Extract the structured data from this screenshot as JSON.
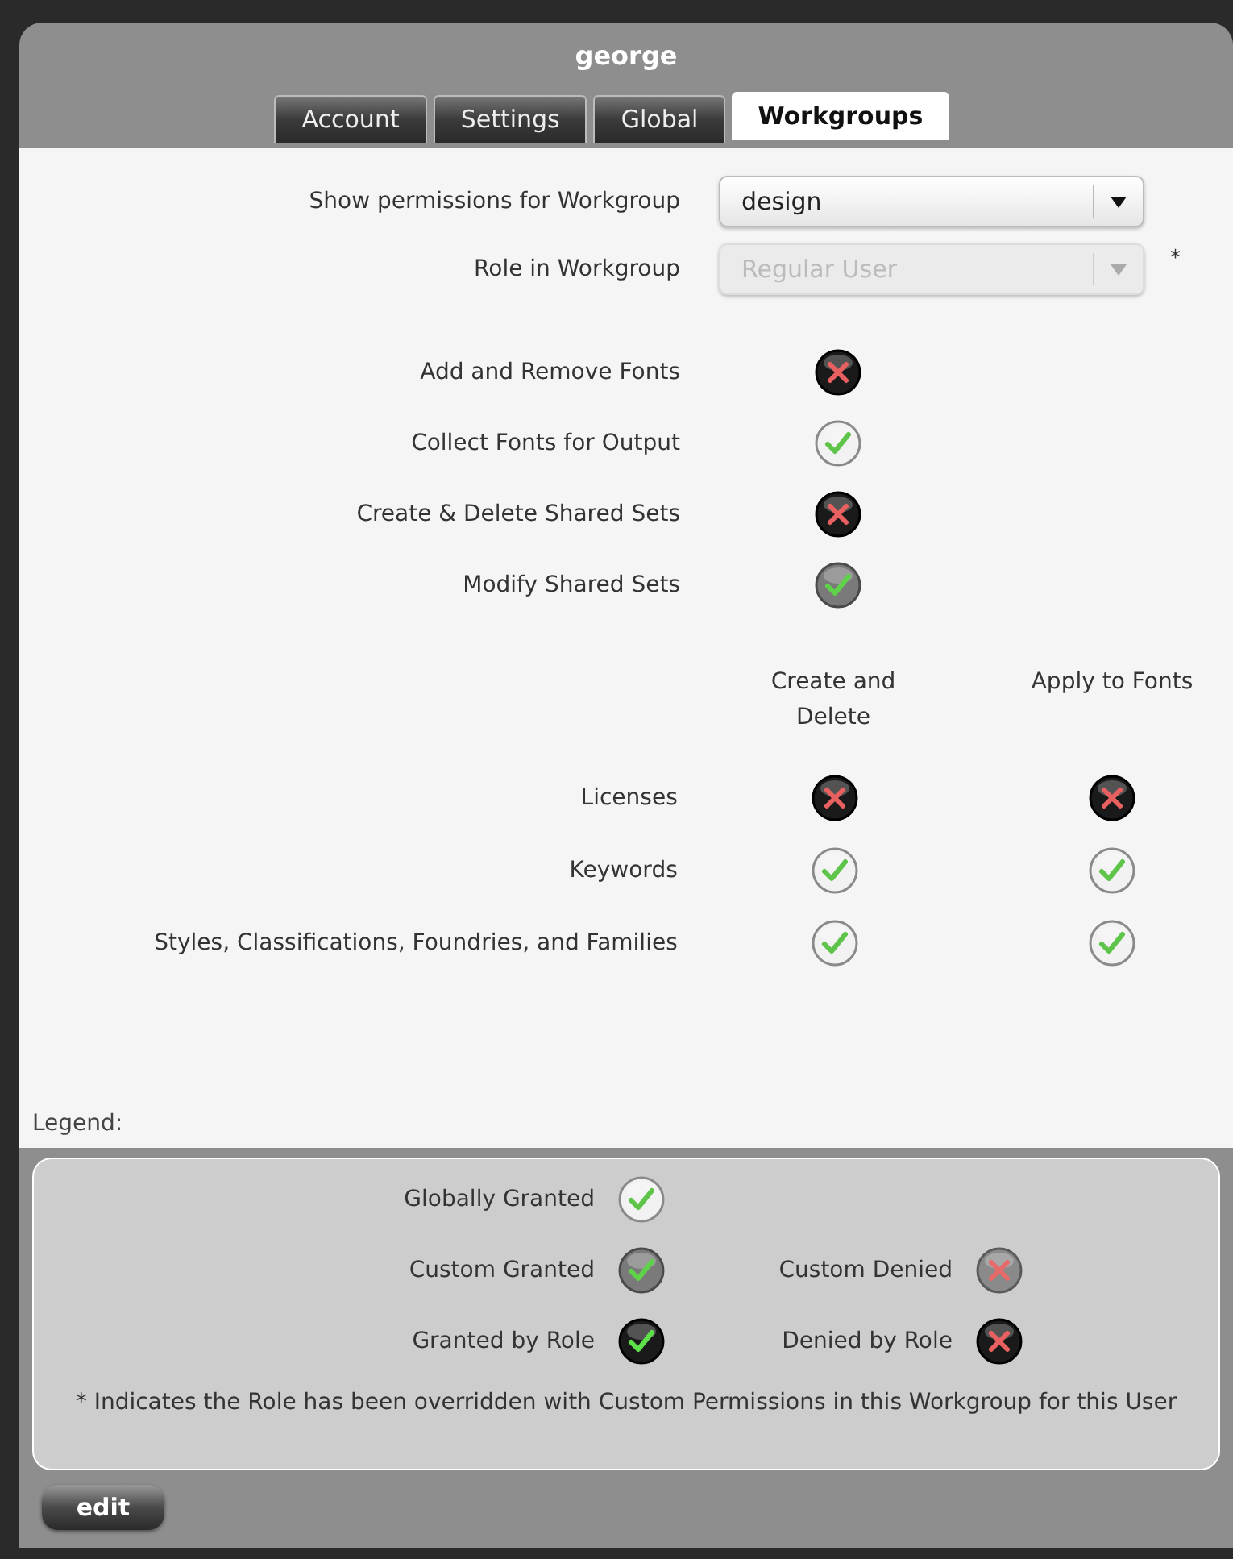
{
  "title": "george",
  "tabs": [
    {
      "label": "Account",
      "selected": false
    },
    {
      "label": "Settings",
      "selected": false
    },
    {
      "label": "Global",
      "selected": false
    },
    {
      "label": "Workgroups",
      "selected": true
    }
  ],
  "workgroup": {
    "label": "Show permissions for Workgroup",
    "value": "design",
    "disabled": false
  },
  "role": {
    "label": "Role in Workgroup",
    "value": "Regular User",
    "disabled": true,
    "overridden_mark": "*"
  },
  "permissions": [
    {
      "label": "Add and Remove Fonts",
      "kind": "role_denied"
    },
    {
      "label": "Collect Fonts for Output",
      "kind": "global_granted"
    },
    {
      "label": "Create & Delete Shared Sets",
      "kind": "role_denied"
    },
    {
      "label": "Modify Shared Sets",
      "kind": "custom_granted"
    }
  ],
  "matrix": {
    "columns": [
      "Create and Delete",
      "Apply to Fonts"
    ],
    "rows": [
      {
        "label": "Licenses",
        "cells": [
          {
            "kind": "role_denied"
          },
          {
            "kind": "role_denied"
          }
        ]
      },
      {
        "label": "Keywords",
        "cells": [
          {
            "kind": "global_granted"
          },
          {
            "kind": "global_granted"
          }
        ]
      },
      {
        "label": "Styles, Classifications, Foundries, and Families",
        "cells": [
          {
            "kind": "global_granted"
          },
          {
            "kind": "global_granted"
          }
        ]
      }
    ]
  },
  "legend": {
    "title": "Legend:",
    "items": [
      {
        "label": "Globally Granted",
        "kind": "global_granted"
      },
      {
        "label": "Custom Granted",
        "kind": "custom_granted"
      },
      {
        "label": "Custom Denied",
        "kind": "custom_denied"
      },
      {
        "label": "Granted by Role",
        "kind": "role_granted"
      },
      {
        "label": "Denied by Role",
        "kind": "role_denied"
      }
    ],
    "note": "* Indicates the Role has been overridden with Custom Permissions in this Workgroup for this User"
  },
  "edit_button": "edit"
}
